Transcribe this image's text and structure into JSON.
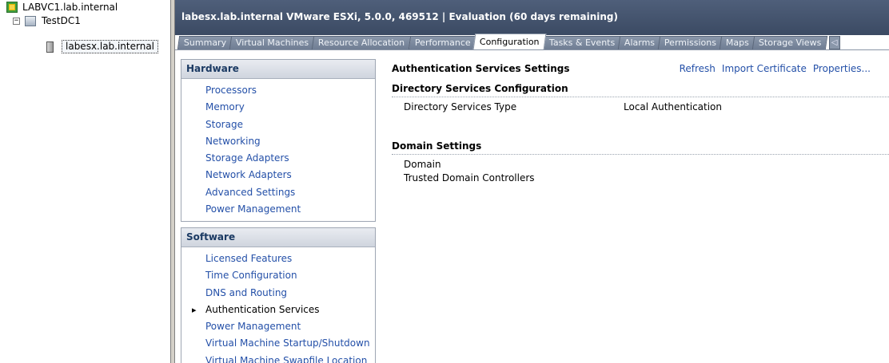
{
  "tree": {
    "vcenter": "LABVC1.lab.internal",
    "datacenter": "TestDC1",
    "host": "labesx.lab.internal",
    "expander": "−"
  },
  "header": {
    "title": "labesx.lab.internal VMware ESXi, 5.0.0, 469512 | Evaluation (60 days remaining)"
  },
  "tabs": [
    {
      "label": "Summary"
    },
    {
      "label": "Virtual Machines"
    },
    {
      "label": "Resource Allocation"
    },
    {
      "label": "Performance"
    },
    {
      "label": "Configuration"
    },
    {
      "label": "Tasks & Events"
    },
    {
      "label": "Alarms"
    },
    {
      "label": "Permissions"
    },
    {
      "label": "Maps"
    },
    {
      "label": "Storage Views"
    }
  ],
  "tab_scroll": "◁",
  "hardware": {
    "header": "Hardware",
    "items": [
      "Processors",
      "Memory",
      "Storage",
      "Networking",
      "Storage Adapters",
      "Network Adapters",
      "Advanced Settings",
      "Power Management"
    ]
  },
  "software": {
    "header": "Software",
    "items": [
      "Licensed Features",
      "Time Configuration",
      "DNS and Routing",
      "Authentication Services",
      "Power Management",
      "Virtual Machine Startup/Shutdown",
      "Virtual Machine Swapfile Location"
    ]
  },
  "detail": {
    "title": "Authentication Services Settings",
    "actions": {
      "refresh": "Refresh",
      "import": "Import Certificate",
      "properties": "Properties..."
    },
    "directory": {
      "header": "Directory Services Configuration",
      "type_label": "Directory Services Type",
      "type_value": "Local Authentication"
    },
    "domain": {
      "header": "Domain Settings",
      "domain_label": "Domain",
      "trusted_label": "Trusted Domain Controllers"
    }
  }
}
